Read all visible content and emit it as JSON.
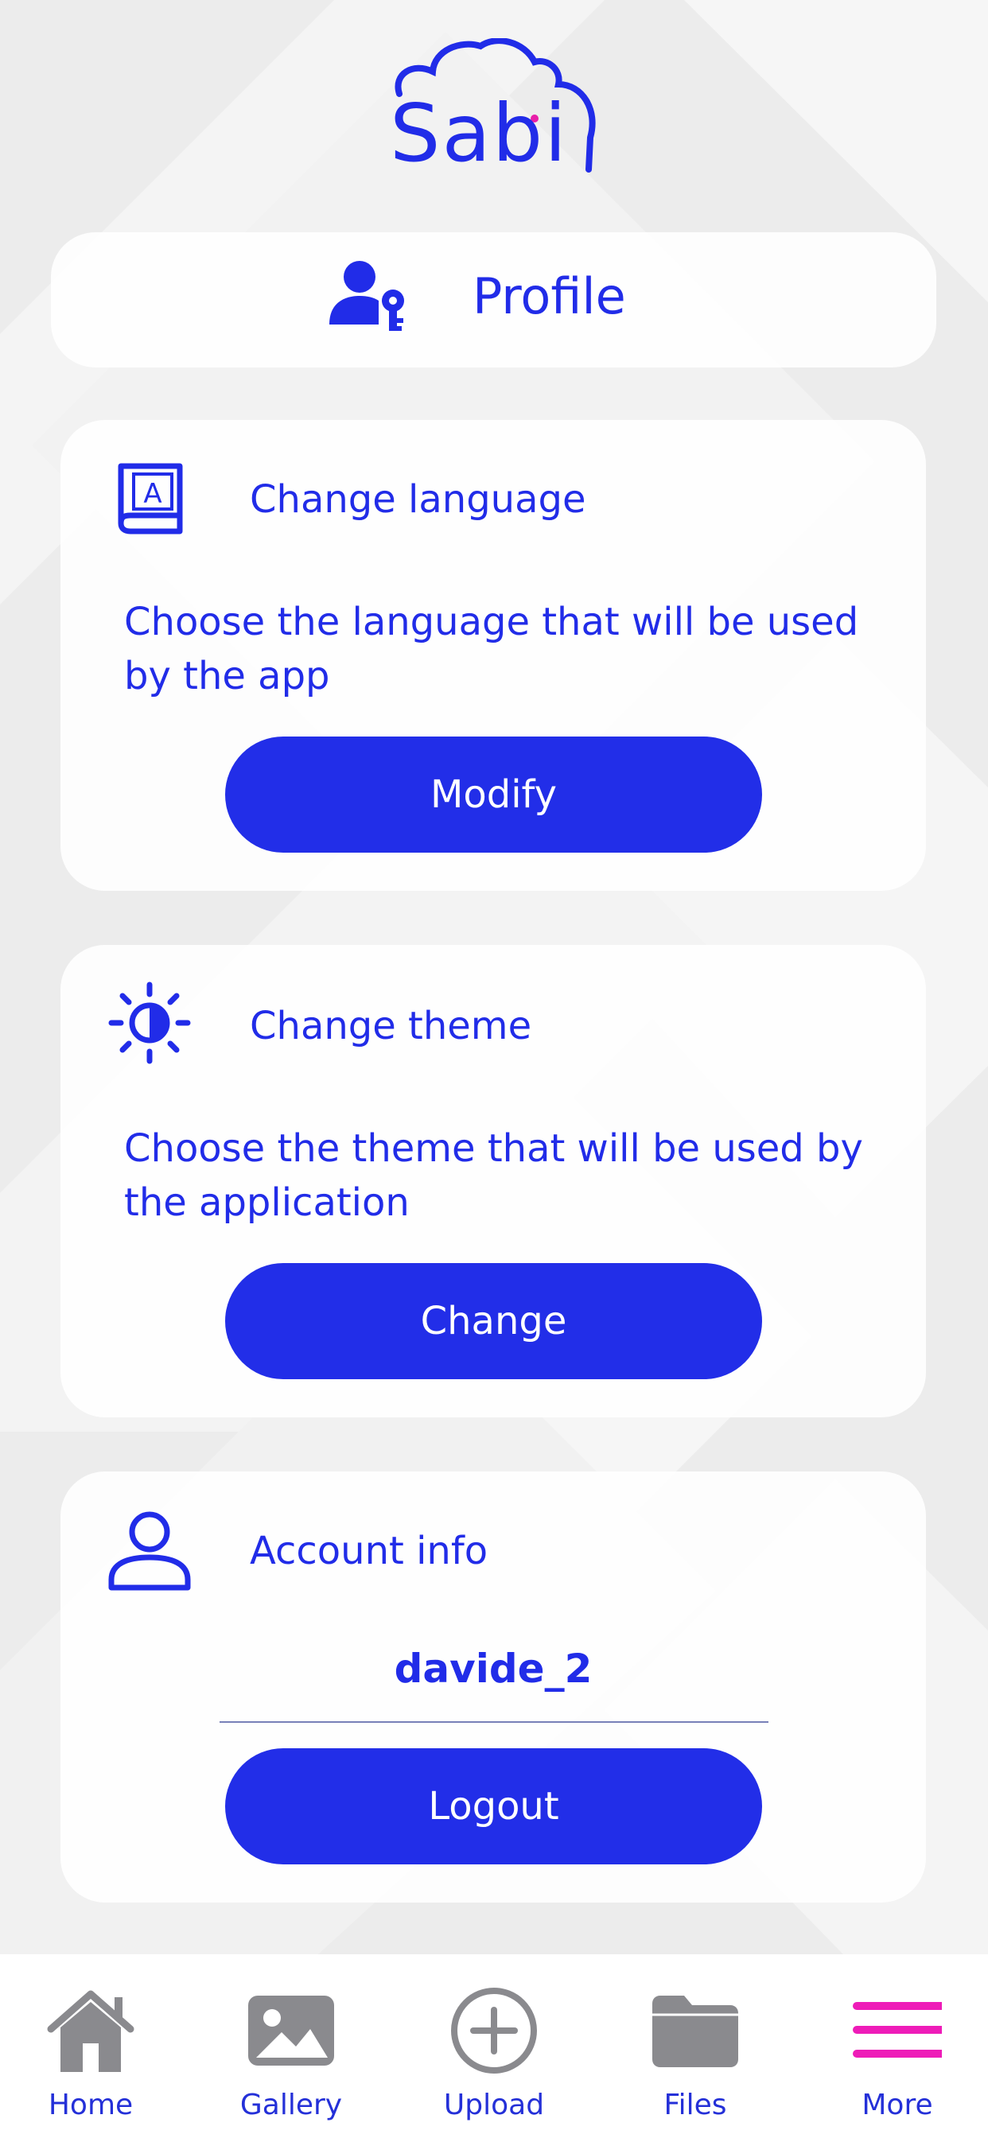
{
  "app": {
    "logo_text": "Sabi",
    "brand_color": "#212ce8",
    "logo_accent_color": "#e81ea8"
  },
  "header": {
    "title": "Profile",
    "icon": "user-key-icon"
  },
  "cards": {
    "language": {
      "icon": "language-book-icon",
      "title": "Change language",
      "description": "Choose the language that will be used by the app",
      "button_label": "Modify"
    },
    "theme": {
      "icon": "brightness-icon",
      "title": "Change theme",
      "description": "Choose the theme that will be used by the application",
      "button_label": "Change"
    },
    "account": {
      "icon": "user-icon",
      "title": "Account info",
      "username": "davide_2",
      "button_label": "Logout"
    }
  },
  "tabbar": {
    "active_tab": "More",
    "active_color": "#ee1cb8",
    "inactive_icon_color": "#8a8a8e",
    "label_color": "#2430d8",
    "items": [
      {
        "label": "Home",
        "icon": "home-icon"
      },
      {
        "label": "Gallery",
        "icon": "image-icon"
      },
      {
        "label": "Upload",
        "icon": "plus-circle-icon"
      },
      {
        "label": "Files",
        "icon": "folder-icon"
      },
      {
        "label": "More",
        "icon": "menu-icon"
      }
    ]
  }
}
